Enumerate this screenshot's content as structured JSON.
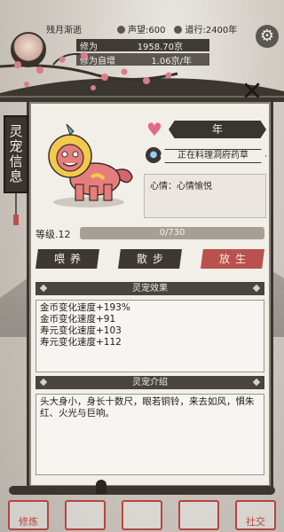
{
  "header": {
    "player_name": "残月渐逝",
    "prestige_label": "声望:600",
    "dao_label": "道行:2400年",
    "cultivation_label": "修为",
    "cultivation_value": "1958.70京",
    "rate_label": "修为自增",
    "rate_value": "1.06京/年"
  },
  "panel": {
    "side_tab": "灵宠信息",
    "pet_name": "年",
    "status": "正在料理洞府药草",
    "mood": "心情：心情愉悦",
    "level_label": "等级.12",
    "level_progress": "0/730",
    "level_fraction": 0,
    "actions": [
      "喂养",
      "散步",
      "放生"
    ],
    "effects_title": "灵宠效果",
    "effects": [
      "金币变化速度+193%",
      "金币变化速度+91",
      "寿元变化速度+103",
      "寿元变化速度+112"
    ],
    "intro_title": "灵宠介绍",
    "intro_text": "头大身小，身长十数尺，眼若铜铃，来去如风，惧朱红、火光与巨响。"
  },
  "nav": [
    "修炼",
    "",
    "",
    "",
    "社交"
  ],
  "colors": {
    "accent_red": "#b9524d",
    "panel_bg": "#f2efe9",
    "ink": "#3b3530"
  },
  "icons": [
    "gear-icon",
    "close-icon",
    "heart-icon",
    "location-pin-icon"
  ]
}
